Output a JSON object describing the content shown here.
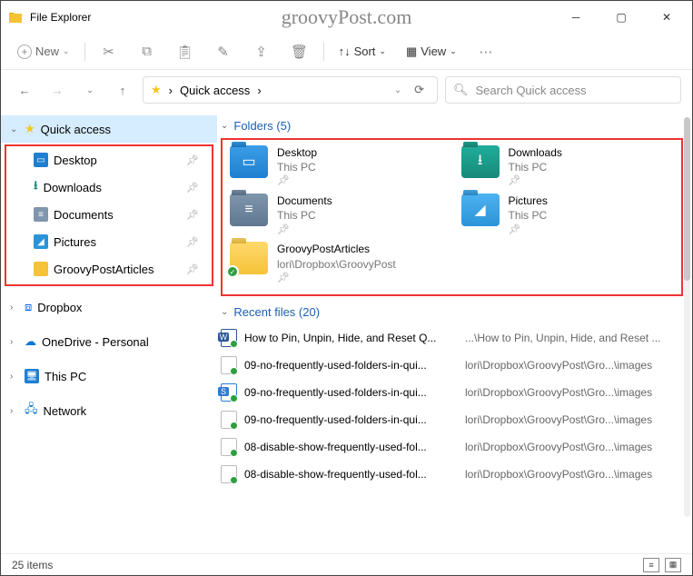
{
  "window": {
    "title": "File Explorer",
    "watermark": "groovyPost.com"
  },
  "toolbar": {
    "new": "New",
    "sort": "Sort",
    "view": "View"
  },
  "breadcrumb": {
    "label": "Quick access",
    "sep": "›"
  },
  "search": {
    "placeholder": "Search Quick access"
  },
  "sidebar": {
    "quick_access": "Quick access",
    "items": [
      {
        "label": "Desktop"
      },
      {
        "label": "Downloads"
      },
      {
        "label": "Documents"
      },
      {
        "label": "Pictures"
      },
      {
        "label": "GroovyPostArticles"
      }
    ],
    "dropbox": "Dropbox",
    "onedrive": "OneDrive - Personal",
    "thispc": "This PC",
    "network": "Network"
  },
  "sections": {
    "folders": "Folders (5)",
    "recent": "Recent files (20)"
  },
  "folders": [
    {
      "name": "Desktop",
      "loc": "This PC"
    },
    {
      "name": "Downloads",
      "loc": "This PC"
    },
    {
      "name": "Documents",
      "loc": "This PC"
    },
    {
      "name": "Pictures",
      "loc": "This PC"
    },
    {
      "name": "GroovyPostArticles",
      "loc": "lori\\Dropbox\\GroovyPost"
    }
  ],
  "recent": [
    {
      "name": "How to Pin, Unpin, Hide, and Reset Q...",
      "path": "...\\How to Pin, Unpin, Hide, and Reset ..."
    },
    {
      "name": "09-no-frequently-used-folders-in-qui...",
      "path": "lori\\Dropbox\\GroovyPost\\Gro...\\images"
    },
    {
      "name": "09-no-frequently-used-folders-in-qui...",
      "path": "lori\\Dropbox\\GroovyPost\\Gro...\\images"
    },
    {
      "name": "09-no-frequently-used-folders-in-qui...",
      "path": "lori\\Dropbox\\GroovyPost\\Gro...\\images"
    },
    {
      "name": "08-disable-show-frequently-used-fol...",
      "path": "lori\\Dropbox\\GroovyPost\\Gro...\\images"
    },
    {
      "name": "08-disable-show-frequently-used-fol...",
      "path": "lori\\Dropbox\\GroovyPost\\Gro...\\images"
    }
  ],
  "status": {
    "items": "25 items"
  }
}
